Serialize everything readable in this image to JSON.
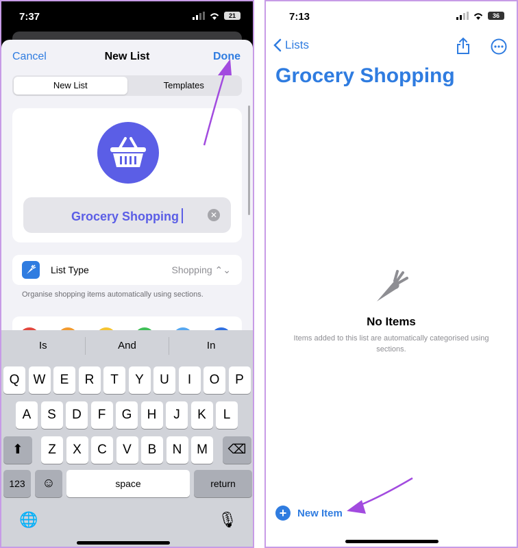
{
  "left": {
    "status": {
      "time": "7:37",
      "battery": "21"
    },
    "nav": {
      "cancel": "Cancel",
      "title": "New List",
      "done": "Done"
    },
    "segments": [
      "New List",
      "Templates"
    ],
    "name_field": {
      "value": "Grocery Shopping",
      "clear_glyph": "✕"
    },
    "list_type": {
      "label": "List Type",
      "value": "Shopping ⌃⌄"
    },
    "hint": "Organise shopping items automatically using sections.",
    "colors": [
      "#e2463d",
      "#f29a2e",
      "#f5c431",
      "#3fbf57",
      "#56a7f0",
      "#2f6fe0"
    ],
    "keyboard": {
      "suggestions": [
        "Is",
        "And",
        "In"
      ],
      "row1": [
        "Q",
        "W",
        "E",
        "R",
        "T",
        "Y",
        "U",
        "I",
        "O",
        "P"
      ],
      "row2": [
        "A",
        "S",
        "D",
        "F",
        "G",
        "H",
        "J",
        "K",
        "L"
      ],
      "row3": [
        "Z",
        "X",
        "C",
        "V",
        "B",
        "N",
        "M"
      ],
      "shift_glyph": "⬆",
      "delete_glyph": "⌫",
      "numbers": "123",
      "emoji_glyph": "☺",
      "space": "space",
      "return": "return",
      "globe_glyph": "🌐",
      "mic_glyph": "🎙"
    }
  },
  "right": {
    "status": {
      "time": "7:13",
      "battery": "36"
    },
    "nav": {
      "back": "Lists"
    },
    "title": "Grocery Shopping",
    "empty": {
      "title": "No Items",
      "subtitle": "Items added to this list are automatically categorised using sections."
    },
    "new_item": {
      "glyph": "+",
      "label": "New Item"
    }
  },
  "accent": "#2f7ce0",
  "arrow_color": "#a24bdf"
}
